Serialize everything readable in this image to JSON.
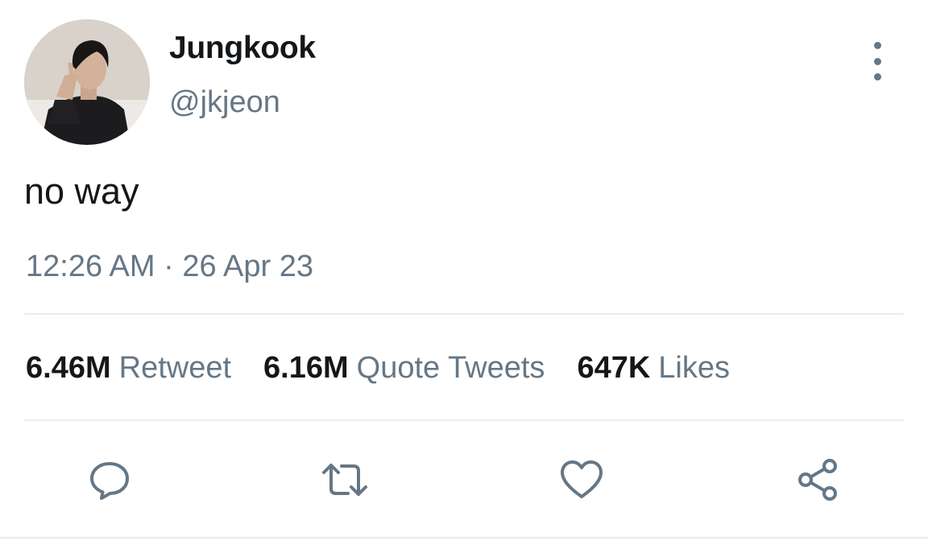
{
  "user": {
    "display_name": "Jungkook",
    "handle": "@jkjeon"
  },
  "tweet": {
    "text": "no way",
    "timestamp": "12:26 AM · 26 Apr 23"
  },
  "stats": [
    {
      "count": "6.46M",
      "label": "Retweet"
    },
    {
      "count": "6.16M",
      "label": "Quote Tweets"
    },
    {
      "count": "647K",
      "label": "Likes"
    }
  ],
  "actions": [
    "reply-icon",
    "retweet-icon",
    "like-icon",
    "share-icon"
  ],
  "colors": {
    "text": "#14171a",
    "secondary": "#657786",
    "divider": "#e6ecf0"
  }
}
